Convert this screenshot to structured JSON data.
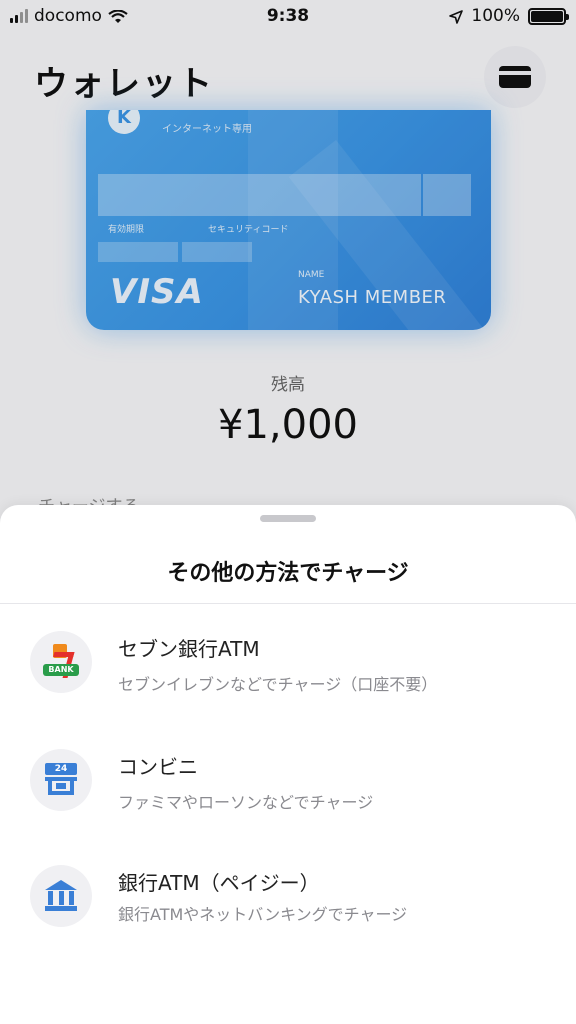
{
  "status_bar": {
    "carrier": "docomo",
    "time": "9:38",
    "battery": "100%"
  },
  "header": {
    "title": "ウォレット"
  },
  "card": {
    "network_text": "インターネット専用",
    "expiry_label": "有効期限",
    "security_label": "セキュリティコード",
    "brand": "VISA",
    "name_label": "NAME",
    "holder_name": "KYASH MEMBER"
  },
  "balance": {
    "label": "残高",
    "amount": "¥1,000"
  },
  "background": {
    "charge_label": "チャージする"
  },
  "sheet": {
    "title": "その他の方法でチャージ",
    "options": [
      {
        "icon": "seven-bank-icon",
        "title": "セブン銀行ATM",
        "subtitle": "セブンイレブンなどでチャージ（口座不要）"
      },
      {
        "icon": "convenience-store-icon",
        "badge": "24",
        "title": "コンビニ",
        "subtitle": "ファミマやローソンなどでチャージ"
      },
      {
        "icon": "bank-icon",
        "title": "銀行ATM（ペイジー）",
        "subtitle": "銀行ATMやネットバンキングでチャージ"
      }
    ]
  },
  "colors": {
    "accent": "#3a7fd6",
    "card": "#3a93e2",
    "seven_orange": "#f08a1c",
    "seven_red": "#e4302b",
    "seven_green": "#2a9d4a"
  }
}
